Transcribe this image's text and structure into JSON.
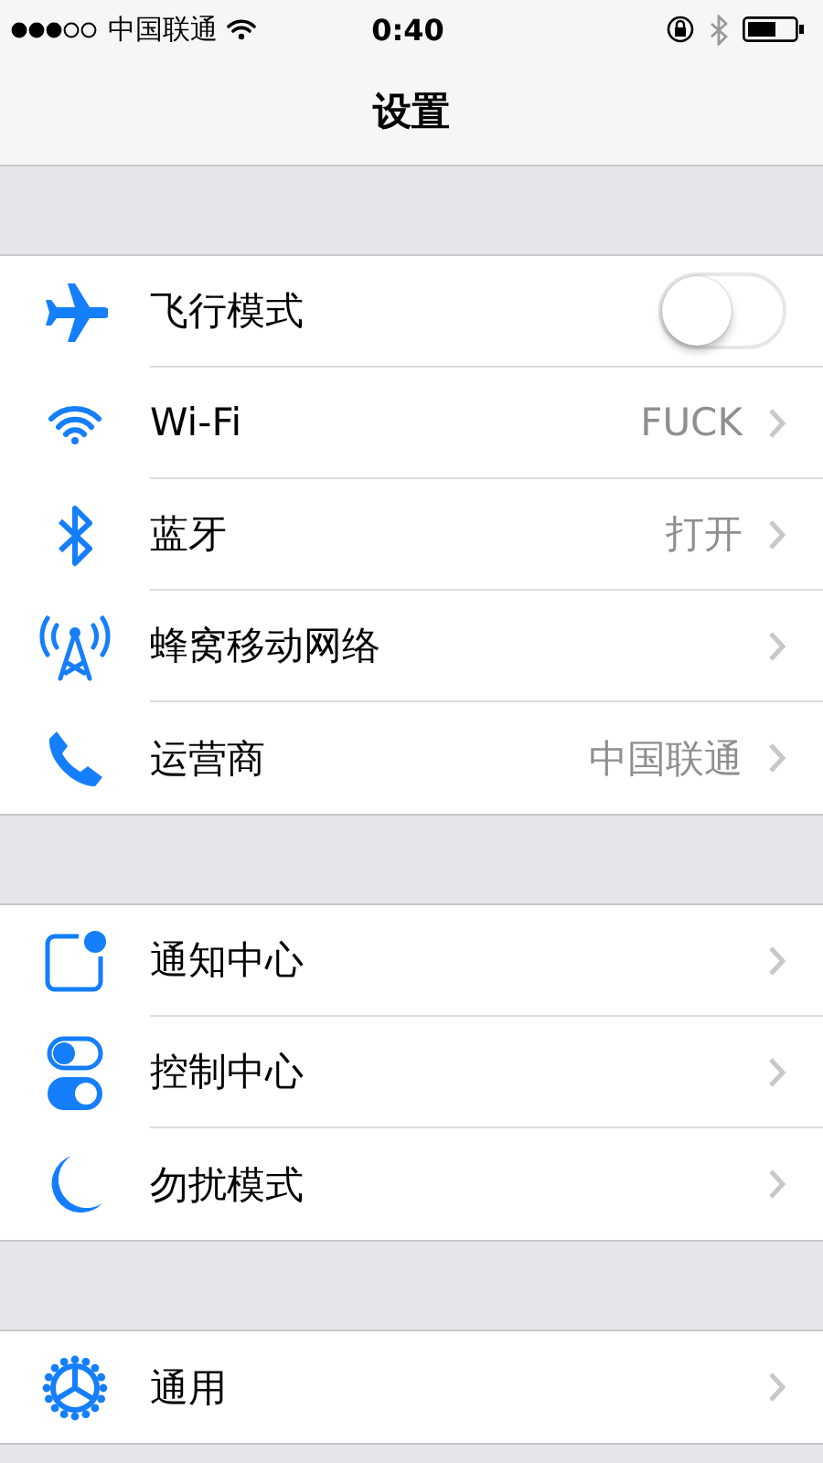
{
  "status_bar": {
    "carrier": "中国联通",
    "time": "0:40"
  },
  "nav_bar": {
    "title": "设置"
  },
  "groups": [
    {
      "items": [
        {
          "label": "飞行模式",
          "kind": "toggle",
          "on": false
        },
        {
          "label": "Wi-Fi",
          "kind": "link",
          "value": "FUCK"
        },
        {
          "label": "蓝牙",
          "kind": "link",
          "value": "打开"
        },
        {
          "label": "蜂窝移动网络",
          "kind": "link"
        },
        {
          "label": "运营商",
          "kind": "link",
          "value": "中国联通"
        }
      ]
    },
    {
      "items": [
        {
          "label": "通知中心",
          "kind": "link"
        },
        {
          "label": "控制中心",
          "kind": "link"
        },
        {
          "label": "勿扰模式",
          "kind": "link"
        }
      ]
    },
    {
      "items": [
        {
          "label": "通用",
          "kind": "link"
        }
      ]
    }
  ]
}
